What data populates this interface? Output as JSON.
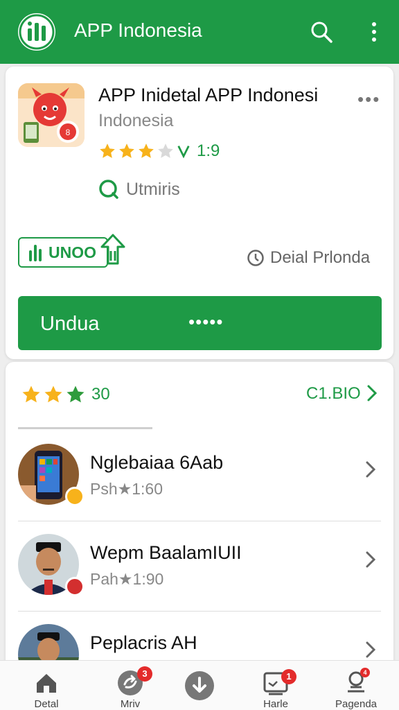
{
  "appbar": {
    "title": "APP Indonesia",
    "icons": [
      "app-logo-icon",
      "search-icon",
      "more-vert-icon"
    ]
  },
  "app": {
    "name": "APP Inidetal APP Indonesi",
    "developer": "Indonesia",
    "rating_text": "1:9",
    "rating_stars": 3.5,
    "badge_text": "Utmiris",
    "install_tag": "UNOO",
    "detail_link": "Deial Prlonda",
    "download_button": "Unduа",
    "download_dots": "•••••"
  },
  "ratings": {
    "value": "30",
    "stars": 3.5,
    "right_text": "C1.BIO"
  },
  "items": [
    {
      "title": "Nglebaiaa 6Aab",
      "sub": "Psh★1:60"
    },
    {
      "title": "Wepm BaalamIUII",
      "sub": "Pah★1:90"
    },
    {
      "title": "Peplacris AH",
      "sub": ""
    }
  ],
  "nav": [
    {
      "label": "Detal",
      "icon": "home-icon",
      "badge": ""
    },
    {
      "label": "Mriv",
      "icon": "swap-icon",
      "badge": "3"
    },
    {
      "label": "",
      "icon": "download-icon",
      "badge": ""
    },
    {
      "label": "Harle",
      "icon": "inbox-icon",
      "badge": "1"
    },
    {
      "label": "Pagenda",
      "icon": "profile-icon",
      "badge": "4"
    }
  ],
  "colors": {
    "primary": "#1e9a46",
    "star": "#f7b21b",
    "badge": "#e32b2b"
  }
}
